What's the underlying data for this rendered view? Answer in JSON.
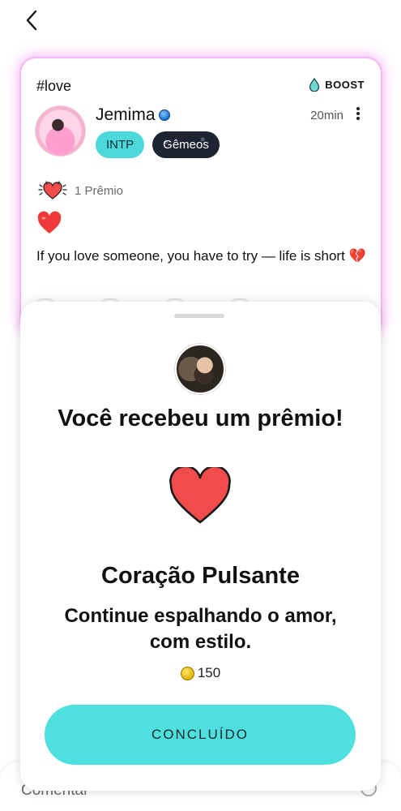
{
  "nav": {
    "back_icon": "chevron-left-icon"
  },
  "post": {
    "tag": "#love",
    "boost_label": "BOOST",
    "boost_icon": "drop-icon",
    "username": "Jemima",
    "time": "20min",
    "badges": [
      "INTP",
      "Gêmeos"
    ],
    "prize_count": "1 Prêmio",
    "text": "If you love someone, you have to try — life is short 💔"
  },
  "sheet": {
    "title": "Você recebeu um prêmio!",
    "award_name": "Coração Pulsante",
    "award_description": "Continue espalhando o amor, com estilo.",
    "coin_amount": "150",
    "button_label": "CONCLUÍDO"
  },
  "comment_bar": {
    "placeholder": "Comentar"
  },
  "colors": {
    "accent": "#4ee0df",
    "heart": "#f24b4b",
    "card_glow": "#ee78ee",
    "badge_zodiac": "#1e2331"
  }
}
